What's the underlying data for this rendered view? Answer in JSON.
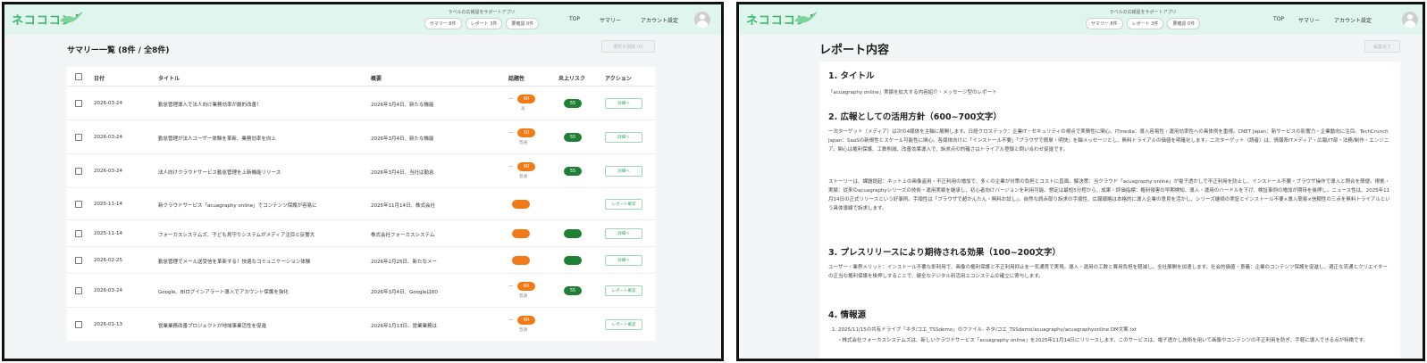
{
  "brand": {
    "logo_text": "ネコココン"
  },
  "header": {
    "promo_title": "ラベルの広報屋をサポートアプリ",
    "pills": [
      "サマリー 8件",
      "レポート 3件",
      "要確認 0件"
    ],
    "nav": [
      "TOP",
      "サマリー",
      "アカウント設定"
    ]
  },
  "left": {
    "page_title": "サマリー一覧 (8件 / 全8件)",
    "bulk_button": "選択を削除 (0)",
    "columns": [
      "日付",
      "タイトル",
      "概要",
      "話題性",
      "炎上リスク",
      "アクション"
    ],
    "rows": [
      {
        "date": "2026-03-24",
        "title": "勤怠管理導入で法人向け業務効率が劇的改善！",
        "summary": "2026年3月4日、新たな機能",
        "topic": "60",
        "topic_sub": "高",
        "risk": "55",
        "action": "詳細へ"
      },
      {
        "date": "2026-03-24",
        "title": "勤怠管理が法人ユーザー体験を革新、業務効率を向上",
        "summary": "2026年3月4日、新たな機能",
        "topic": "50",
        "topic_sub": "普通",
        "risk": "55",
        "action": "詳細へ"
      },
      {
        "date": "2026-03-24",
        "title": "法人向けクラウドサービス勤怠管理を上新機能リリース",
        "summary": "2026年3月4日、当社は勤怠",
        "topic": "60",
        "topic_sub": "普通",
        "risk": "55",
        "action": "詳細へ"
      },
      {
        "date": "2025-11-14",
        "title": "新クラウドサービス「acuagraphy online」でコンテンツ保護が容易に",
        "summary": "2025年11月14日、株式会社",
        "topic": "",
        "topic_sub": "",
        "risk": "",
        "action": "レポート確認"
      },
      {
        "date": "2025-11-14",
        "title": "フォーカスシステムズ、子ども見守りシステムがメディア注目と反響大",
        "summary": "株式会社フォーカスシステム",
        "topic": "",
        "topic_sub": "",
        "risk": "",
        "action": "詳細へ"
      },
      {
        "date": "2026-02-25",
        "title": "勤怠管理でメール送受信を革新する！快適なコミュニケーション体験",
        "summary": "2026年2月25日、新たなメー",
        "topic": "",
        "topic_sub": "",
        "risk": "",
        "action": "詳細へ"
      },
      {
        "date": "2026-03-24",
        "title": "Google、BIログインアラート導入でアカウント保護を強化",
        "summary": "2026年3月4日、Googleは60",
        "topic": "60",
        "topic_sub": "普通",
        "risk": "55",
        "action": "レポート確認"
      },
      {
        "date": "2026-01-13",
        "title": "営業業務改善プロジェクトが地域事業活性を促進",
        "summary": "2026年1月13日、営業業務は",
        "topic": "60",
        "topic_sub": "普通",
        "risk": "",
        "action": "レポート確認"
      }
    ]
  },
  "right": {
    "page_title": "レポート内容",
    "edit_button": "編集完了",
    "sec1": {
      "heading": "1. タイトル",
      "body": "「acuagraphy online」実績を拡大する内容紹介・メッセージ型のレポート"
    },
    "sec2": {
      "heading": "2. 広報としての活用方針（600~700文字）",
      "body1": "一次ターゲット（メディア）は次の4媒体を主軸に展開します。日経クロステック：企業IT・セキュリティの視点で実務性に関心。ITmedia：導入容易性・運用効率性への具体例を重視。CNET Japan：新サービスの影響力・企業動向に注目。TechCrunch Japan：SaaSの新規性とスケール可能性に関心。各媒体向けに「インストール不要」「ブラウザで簡単・明快」を軸メッセージとし、無料トライアルの価値を明確化します。二次ターゲット（読者）は、情報系ITメディア・広報/IT部・法務/制作・エンジニア。関心は権利保護、工数削減、改善効果導入で、訴求点の的確さはトライアル登録と問い合わせ促進です。",
      "body2": "ストーリーは、課題提起：ネット上の画像盗用・不正利用の増加で、多くの企業が対策の負担とコストに直面。解決策：当クラウド「acuagraphy online」が電子透かしで不正利用を防止し、インストール不要・ブラウザ操作で導入と照合を簡便。根拠・実績：従来のacuagraphyシリーズの技術・運用実績を継承し、初心者向けバージョンを利用可能。想定は最短5分程から、成果・評価指標：権利侵害の早期検知、導入・運用のハードルを下げ、検証事例の増加が期待を後押し。ニュース性は、2025年11月14日の正式リリースという好事例。手順性は「ブラウザで超かんたん・無料お試し」。自然な読み取り訴求の手順性、広報戦略は本格的に導入企業の意見を活かし、シリーズ継続の実証とインストール不要×導入簡易×信頼性の三点を無料トライアルという具体導線で訴求します。"
    },
    "sec3": {
      "heading": "3. プレスリリースにより期待される効果（100~200文字）",
      "body": "ユーザー・業界メリット：インストール不要な即利用で、画像の権利保護と不正利用抑止を一気通貫で実現。導入・運用の工数と費用負担を軽減し、全社展開を加速します。社会的価値・意義：企業のコンテンツ保護を促進し、適正な流通とクリエイターの正当な権利保護を後押しすることで、健全なデジタル利活用エコシステムの確立に寄与します。"
    },
    "sec4": {
      "heading": "4. 情報源",
      "item1": "1. 2025/11/15の共有ドライブ「ネタ/コエ_TSSdemo」のファイル: ネタ/コエ_TSSdemo/acuagraphy/acuagraphyonline DM文案.txt",
      "item2": "・株式会社フォーカスシステムズは、新しいクラウドサービス「acuagraphy online」を2025年11月14日にリリースします。このサービスは、電子透かし技術を用いて画像やコンテンツの不正利用を防ぎ、手軽に導入できる点が特徴です。"
    }
  }
}
